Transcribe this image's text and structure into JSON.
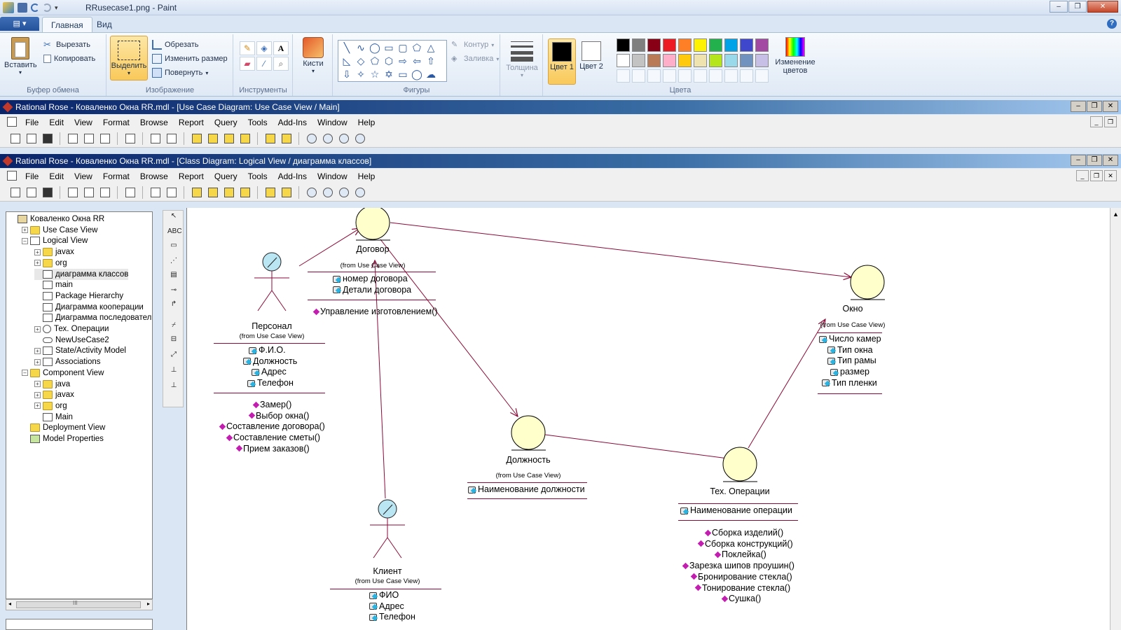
{
  "paint": {
    "title": "RRusecase1.png - Paint",
    "file_tab": "▤ ▾",
    "tabs": [
      "Главная",
      "Вид"
    ],
    "help": "?",
    "window_buttons": [
      "–",
      "❐",
      "✕"
    ],
    "clipboard": {
      "paste": "Вставить",
      "cut": "Вырезать",
      "copy": "Копировать",
      "label": "Буфер обмена"
    },
    "image": {
      "select": "Выделить",
      "crop": "Обрезать",
      "resize": "Изменить размер",
      "rotate": "Повернуть",
      "label": "Изображение"
    },
    "tools": {
      "label": "Инструменты"
    },
    "brushes": {
      "label": "Кисти"
    },
    "shapes": {
      "label": "Фигуры",
      "outline": "Контур",
      "fill": "Заливка"
    },
    "thickness": {
      "label": "Толщина"
    },
    "colors": {
      "color1": "Цвет 1",
      "color2": "Цвет 2",
      "edit": "Изменение цветов",
      "label": "Цвета",
      "color1_value": "#000000",
      "color2_value": "#ffffff",
      "palette_row1": [
        "#000000",
        "#7f7f7f",
        "#880015",
        "#ed1c24",
        "#ff7f27",
        "#fff200",
        "#22b14c",
        "#00a2e8",
        "#3f48cc",
        "#a349a4"
      ],
      "palette_row2": [
        "#ffffff",
        "#c3c3c3",
        "#b97a57",
        "#ffaec9",
        "#ffc90e",
        "#efe4b0",
        "#b5e61d",
        "#99d9ea",
        "#7092be",
        "#c8bfe7"
      ]
    }
  },
  "rose_back": {
    "title": "Rational Rose - Коваленко Окна RR.mdl - [Use Case Diagram: Use Case View / Main]",
    "menu": [
      "File",
      "Edit",
      "View",
      "Format",
      "Browse",
      "Report",
      "Query",
      "Tools",
      "Add-Ins",
      "Window",
      "Help"
    ]
  },
  "rose_front": {
    "title": "Rational Rose - Коваленко Окна RR.mdl - [Class Diagram: Logical View / диаграмма классов]",
    "menu": [
      "File",
      "Edit",
      "View",
      "Format",
      "Browse",
      "Report",
      "Query",
      "Tools",
      "Add-Ins",
      "Window",
      "Help"
    ]
  },
  "browser": {
    "items": [
      {
        "label": "Коваленко Окна RR",
        "level": 0,
        "icon": "model",
        "exp": ""
      },
      {
        "label": "Use Case View",
        "level": 1,
        "icon": "folder",
        "exp": "+"
      },
      {
        "label": "Logical View",
        "level": 1,
        "icon": "logical",
        "exp": "–"
      },
      {
        "label": "javax",
        "level": 2,
        "icon": "folder",
        "exp": "+"
      },
      {
        "label": "org",
        "level": 2,
        "icon": "folder",
        "exp": "+"
      },
      {
        "label": "диаграмма классов",
        "level": 2,
        "icon": "doc",
        "exp": ""
      },
      {
        "label": "main",
        "level": 2,
        "icon": "doc",
        "exp": ""
      },
      {
        "label": "Package Hierarchy",
        "level": 2,
        "icon": "doc",
        "exp": ""
      },
      {
        "label": "Диаграмма кооперации",
        "level": 2,
        "icon": "doc",
        "exp": ""
      },
      {
        "label": "Диаграмма последовательн",
        "level": 2,
        "icon": "doc",
        "exp": ""
      },
      {
        "label": "Тех. Операции",
        "level": 2,
        "icon": "entity",
        "exp": "+"
      },
      {
        "label": "NewUseCase2",
        "level": 2,
        "icon": "usecase",
        "exp": ""
      },
      {
        "label": "State/Activity Model",
        "level": 2,
        "icon": "state",
        "exp": "+"
      },
      {
        "label": "Associations",
        "level": 2,
        "icon": "assoc",
        "exp": "+"
      },
      {
        "label": "Component View",
        "level": 1,
        "icon": "folder",
        "exp": "–"
      },
      {
        "label": "java",
        "level": 2,
        "icon": "folder",
        "exp": "+"
      },
      {
        "label": "javax",
        "level": 2,
        "icon": "folder",
        "exp": "+"
      },
      {
        "label": "org",
        "level": 2,
        "icon": "folder",
        "exp": "+"
      },
      {
        "label": "Main",
        "level": 2,
        "icon": "doc",
        "exp": ""
      },
      {
        "label": "Deployment View",
        "level": 1,
        "icon": "deploy",
        "exp": ""
      },
      {
        "label": "Model Properties",
        "level": 1,
        "icon": "props",
        "exp": ""
      }
    ],
    "scroll_mark": "III"
  },
  "palette_tools": [
    "↖",
    "ABC",
    "▭",
    "⋰",
    "▤",
    "⊸",
    "↱",
    "⌿",
    "⊟",
    "⤢",
    "⊥",
    "⊥"
  ],
  "diagram": {
    "from_label": "(from Use Case View)",
    "classes": {
      "dogovor": {
        "name": "Договор",
        "attrs": [
          "номер договора",
          "Детали договора"
        ],
        "ops": [
          "Управление изготовлением()"
        ]
      },
      "personal": {
        "name": "Персонал",
        "attrs": [
          "Ф.И.О.",
          "Должность",
          "Адрес",
          "Телефон"
        ],
        "ops": [
          "Замер()",
          "Выбор окна()",
          "Составление договора()",
          "Составление сметы()",
          "Прием заказов()"
        ]
      },
      "okno": {
        "name": "Окно",
        "attrs": [
          "Число камер",
          "Тип окна",
          "Тип рамы",
          "размер",
          "Тип пленки"
        ]
      },
      "dolzhnost": {
        "name": "Должность",
        "attrs": [
          "Наименование должности"
        ]
      },
      "tekh": {
        "name": "Тех. Операции",
        "attrs": [
          "Наименование операции"
        ],
        "ops": [
          "Сборка изделий()",
          "Сборка конструкций()",
          "Поклейка()",
          "Зарезка шипов проушин()",
          "Бронирование стекла()",
          "Тонирование стекла()",
          "Сушка()"
        ]
      },
      "klient": {
        "name": "Клиент",
        "attrs": [
          "ФИО",
          "Адрес",
          "Телефон"
        ]
      }
    },
    "line_color": "#8b0a38",
    "entity_fill": "#ffffcc"
  }
}
